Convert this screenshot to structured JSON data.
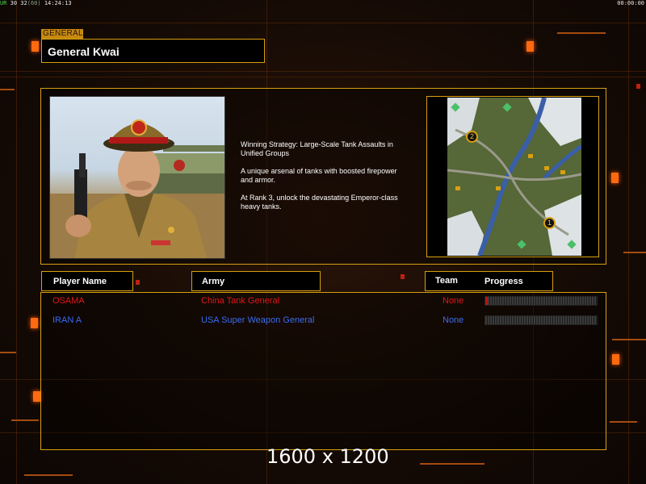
{
  "status_bar": {
    "left_prefix": "UR",
    "left_values": "30 32",
    "left_paren": "(60)",
    "left_time": "14:24:13",
    "right_time": "00:00:00"
  },
  "general": {
    "tag": "GENERAL",
    "name": "General Kwai",
    "description": [
      "Winning Strategy: Large-Scale Tank Assaults in\n Unified Groups",
      "A unique arsenal of tanks with boosted firepower\n and armor.",
      "At Rank 3, unlock the devastating Emperor-class\n heavy tanks."
    ]
  },
  "minimap": {
    "start_positions": [
      "2",
      "1"
    ]
  },
  "table": {
    "headers": {
      "player_name": "Player Name",
      "army": "Army",
      "team": "Team",
      "progress": "Progress"
    },
    "rows": [
      {
        "player": "OSAMA",
        "army": "China Tank General",
        "team": "None",
        "progress": 0.01,
        "color": "#e01818"
      },
      {
        "player": "IRAN A",
        "army": "USA Super Weapon General",
        "team": "None",
        "progress": 0,
        "color": "#3a6cf0"
      }
    ]
  },
  "resolution_label": "1600 x 1200",
  "colors": {
    "accent": "#d8a010",
    "lamp": "#ff6a10"
  }
}
